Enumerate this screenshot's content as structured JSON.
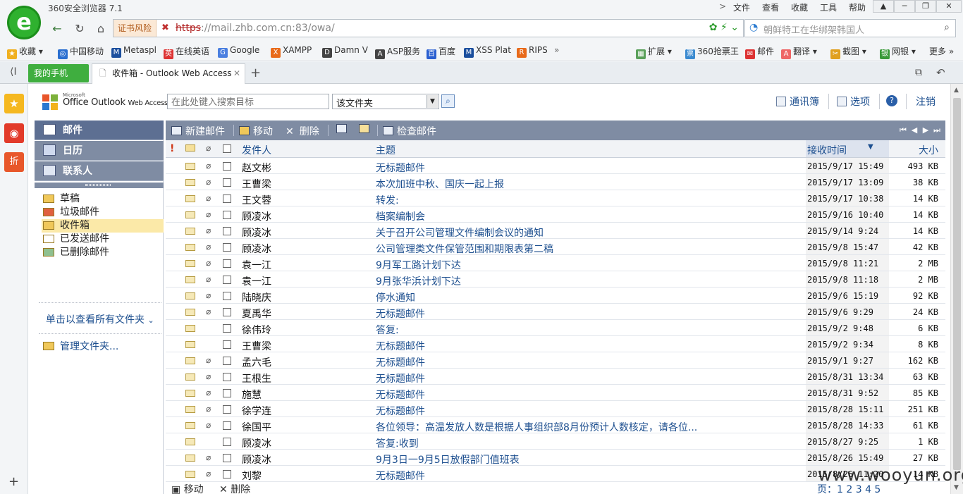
{
  "browser": {
    "title": "360安全浏览器 7.1",
    "menu": [
      "文件",
      "查看",
      "收藏",
      "工具",
      "帮助"
    ],
    "cert_warning": "证书风险",
    "url_https": "https",
    "url_rest": "://mail.zhb.com.cn:83/owa/",
    "search_placeholder": "朝鲜特工在华绑架韩国人",
    "bookmarks": [
      "收藏",
      "中国移动",
      "Metaspl",
      "在线英语",
      "Google",
      "XAMPP",
      "Damn V",
      "ASP服务",
      "百度",
      "XSS Plat",
      "RIPS"
    ],
    "right_tools": [
      "扩展",
      "360抢票王",
      "邮件",
      "翻译",
      "截图",
      "网银",
      "更多"
    ],
    "mobile_tab": "我的手机",
    "tab_title": "收件箱 - Outlook Web Access"
  },
  "owa": {
    "logo_ms": "Microsoft",
    "logo_name": "Office Outlook",
    "logo_suffix": "Web Access",
    "search_placeholder": "在此处键入搜索目标",
    "scope": "该文件夹",
    "top_links": {
      "addressbook": "通讯簿",
      "options": "选项",
      "logout": "注销"
    },
    "nav": {
      "mail": "邮件",
      "calendar": "日历",
      "contacts": "联系人"
    },
    "folders": [
      "草稿",
      "垃圾邮件",
      "收件箱",
      "已发送邮件",
      "已删除邮件"
    ],
    "view_all": "单击以查看所有文件夹",
    "manage": "管理文件夹...",
    "toolbar": {
      "new": "新建邮件",
      "move": "移动",
      "delete": "删除",
      "check": "检查邮件"
    },
    "columns": {
      "from": "发件人",
      "subject": "主题",
      "received": "接收时间",
      "size": "大小"
    },
    "bottom": {
      "move": "移动",
      "delete": "删除",
      "page": "页：1 2 3 4 5"
    },
    "emails": [
      {
        "from": "赵文彬",
        "subject": "无标题邮件",
        "date": "2015/9/17 15:49",
        "size": "493 KB",
        "attach": true
      },
      {
        "from": "王曹梁",
        "subject": "本次加班中秋、国庆一起上报",
        "date": "2015/9/17 13:09",
        "size": "38 KB",
        "attach": true
      },
      {
        "from": "王文蓉",
        "subject": "转发:",
        "date": "2015/9/17 10:38",
        "size": "14 KB",
        "attach": true
      },
      {
        "from": "顾凌冰",
        "subject": "档案编制会",
        "date": "2015/9/16 10:40",
        "size": "14 KB",
        "attach": true
      },
      {
        "from": "顾凌冰",
        "subject": "关于召开公司管理文件编制会议的通知",
        "date": "2015/9/14 9:24",
        "size": "14 KB",
        "attach": true
      },
      {
        "from": "顾凌冰",
        "subject": "公司管理类文件保管范围和期限表第二稿",
        "date": "2015/9/8 15:47",
        "size": "42 KB",
        "attach": true
      },
      {
        "from": "袁一江",
        "subject": "9月军工路计划下达",
        "date": "2015/9/8 11:21",
        "size": "2 MB",
        "attach": true
      },
      {
        "from": "袁一江",
        "subject": "9月张华浜计划下达",
        "date": "2015/9/8 11:18",
        "size": "2 MB",
        "attach": true
      },
      {
        "from": "陆晓庆",
        "subject": "停水通知",
        "date": "2015/9/6 15:19",
        "size": "92 KB",
        "attach": true
      },
      {
        "from": "夏禹华",
        "subject": "无标题邮件",
        "date": "2015/9/6 9:29",
        "size": "24 KB",
        "attach": true
      },
      {
        "from": "徐伟玲",
        "subject": "答复:",
        "date": "2015/9/2 9:48",
        "size": "6 KB",
        "attach": false
      },
      {
        "from": "王曹梁",
        "subject": "无标题邮件",
        "date": "2015/9/2 9:34",
        "size": "8 KB",
        "attach": false
      },
      {
        "from": "孟六毛",
        "subject": "无标题邮件",
        "date": "2015/9/1 9:27",
        "size": "162 KB",
        "attach": true
      },
      {
        "from": "王根生",
        "subject": "无标题邮件",
        "date": "2015/8/31 13:34",
        "size": "63 KB",
        "attach": true
      },
      {
        "from": "施慧",
        "subject": "无标题邮件",
        "date": "2015/8/31 9:52",
        "size": "85 KB",
        "attach": true
      },
      {
        "from": "徐学连",
        "subject": "无标题邮件",
        "date": "2015/8/28 15:11",
        "size": "251 KB",
        "attach": true
      },
      {
        "from": "徐国平",
        "subject": "各位领导：高温发放人数是根据人事组织部8月份预计人数核定，请各位...",
        "date": "2015/8/28 14:33",
        "size": "61 KB",
        "attach": true
      },
      {
        "from": "顾凌冰",
        "subject": "答复:收到",
        "date": "2015/8/27 9:25",
        "size": "1 KB",
        "attach": false
      },
      {
        "from": "顾凌冰",
        "subject": "9月3日一9月5日放假部门值班表",
        "date": "2015/8/26 15:49",
        "size": "27 KB",
        "attach": true
      },
      {
        "from": "刘黎",
        "subject": "无标题邮件",
        "date": "2015/8/26 11:20",
        "size": "14 KB",
        "attach": true
      }
    ]
  },
  "watermark": "www.wooyun.org"
}
